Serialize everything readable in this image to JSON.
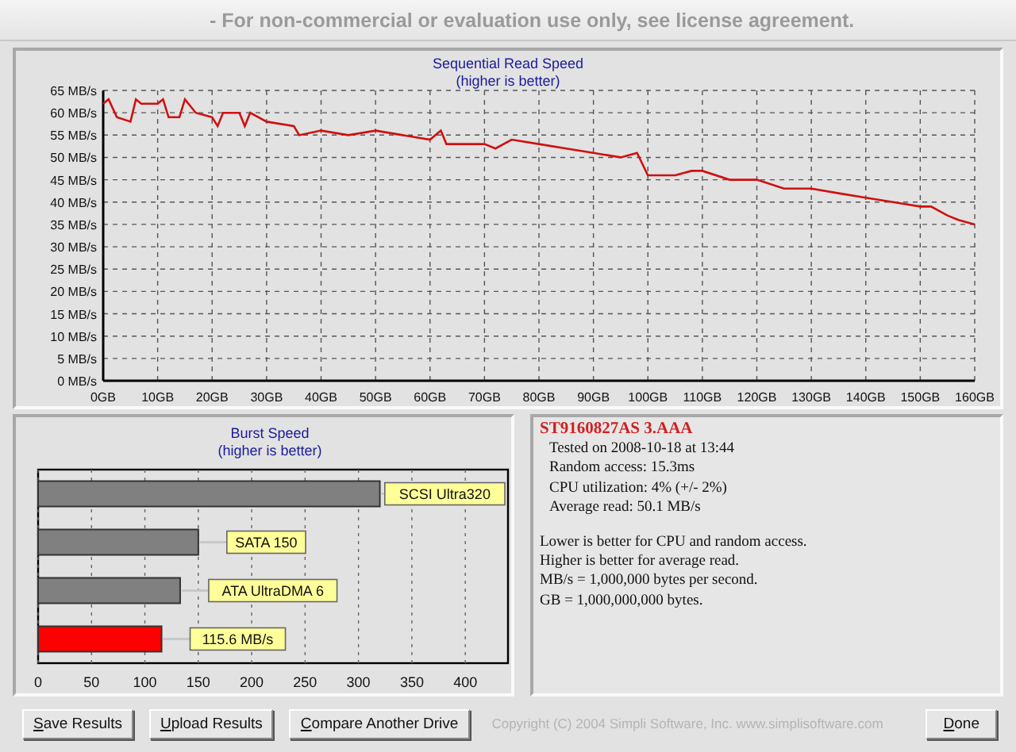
{
  "window": {
    "title": "- For non-commercial or evaluation use only, see license agreement."
  },
  "sequential_chart": {
    "chart_data": {
      "type": "line",
      "title": "Sequential Read Speed",
      "subtitle": "(higher is better)",
      "x": [
        0,
        1,
        2.5,
        5,
        6,
        7,
        10,
        11,
        12,
        14,
        15,
        17,
        20,
        21,
        22,
        25,
        26,
        27,
        30,
        35,
        36,
        40,
        45,
        50,
        55,
        60,
        62,
        63,
        65,
        70,
        72,
        75,
        80,
        85,
        90,
        95,
        98,
        100,
        105,
        108,
        110,
        115,
        120,
        125,
        130,
        135,
        140,
        145,
        150,
        152,
        155,
        157,
        160
      ],
      "grid": true,
      "series": [
        {
          "color": "#d01010",
          "values": [
            62,
            63,
            59,
            58,
            63,
            62,
            62,
            63,
            59,
            59,
            63,
            60,
            59,
            57,
            60,
            60,
            57,
            60,
            58,
            57,
            55,
            56,
            55,
            56,
            55,
            54,
            56,
            53,
            53,
            53,
            52,
            54,
            53,
            52,
            51,
            50,
            51,
            46,
            46,
            47,
            47,
            45,
            45,
            43,
            43,
            42,
            41,
            40,
            39,
            39,
            37,
            36,
            35
          ]
        }
      ],
      "xlim": [
        0,
        160
      ],
      "ylim": [
        0,
        65
      ],
      "xticks": [
        {
          "value": 0,
          "label": "0GB"
        },
        {
          "value": 10,
          "label": "10GB"
        },
        {
          "value": 20,
          "label": "20GB"
        },
        {
          "value": 30,
          "label": "30GB"
        },
        {
          "value": 40,
          "label": "40GB"
        },
        {
          "value": 50,
          "label": "50GB"
        },
        {
          "value": 60,
          "label": "60GB"
        },
        {
          "value": 70,
          "label": "70GB"
        },
        {
          "value": 80,
          "label": "80GB"
        },
        {
          "value": 90,
          "label": "90GB"
        },
        {
          "value": 100,
          "label": "100GB"
        },
        {
          "value": 110,
          "label": "110GB"
        },
        {
          "value": 120,
          "label": "120GB"
        },
        {
          "value": 130,
          "label": "130GB"
        },
        {
          "value": 140,
          "label": "140GB"
        },
        {
          "value": 150,
          "label": "150GB"
        },
        {
          "value": 160,
          "label": "160GB"
        }
      ],
      "yticks": [
        {
          "value": 0,
          "label": "0 MB/s"
        },
        {
          "value": 5,
          "label": "5 MB/s"
        },
        {
          "value": 10,
          "label": "10 MB/s"
        },
        {
          "value": 15,
          "label": "15 MB/s"
        },
        {
          "value": 20,
          "label": "20 MB/s"
        },
        {
          "value": 25,
          "label": "25 MB/s"
        },
        {
          "value": 30,
          "label": "30 MB/s"
        },
        {
          "value": 35,
          "label": "35 MB/s"
        },
        {
          "value": 40,
          "label": "40 MB/s"
        },
        {
          "value": 45,
          "label": "45 MB/s"
        },
        {
          "value": 50,
          "label": "50 MB/s"
        },
        {
          "value": 55,
          "label": "55 MB/s"
        },
        {
          "value": 60,
          "label": "60 MB/s"
        },
        {
          "value": 65,
          "label": "65 MB/s"
        }
      ]
    }
  },
  "burst_chart": {
    "chart_data": {
      "type": "bar",
      "orientation": "horizontal",
      "title": "Burst Speed",
      "subtitle": "(higher is better)",
      "categories": [
        "SCSI Ultra320",
        "SATA 150",
        "ATA UltraDMA 6",
        "115.6 MB/s"
      ],
      "grid": true,
      "series": [
        {
          "color": "#808080",
          "values": [
            320,
            150,
            133,
            null
          ]
        },
        {
          "color": "#ff0000",
          "values": [
            null,
            null,
            null,
            115.6
          ]
        }
      ],
      "xlim": [
        0,
        440
      ],
      "xticks": [
        0,
        50,
        100,
        150,
        200,
        250,
        300,
        350,
        400
      ]
    }
  },
  "results": {
    "drive": "ST9160827AS 3.AAA",
    "details": [
      "Tested on 2008-10-18 at 13:44",
      "Random access: 15.3ms",
      "CPU utilization: 4% (+/- 2%)",
      "Average read: 50.1 MB/s"
    ],
    "notes": [
      "Lower is better for CPU and random access.",
      "Higher is better for average read.",
      "MB/s = 1,000,000 bytes per second.",
      "GB = 1,000,000,000 bytes."
    ]
  },
  "buttons": [
    "Save Results",
    "Upload Results",
    "Compare Another Drive"
  ],
  "copyright": "Copyright (C) 2004 Simpli Software, Inc. www.simplisoftware.com",
  "done_button": "Done"
}
